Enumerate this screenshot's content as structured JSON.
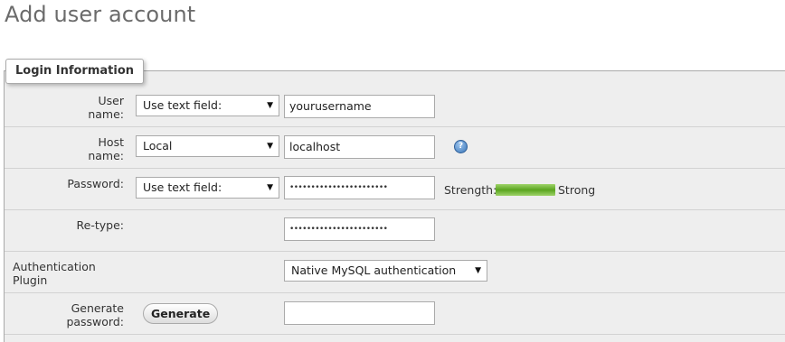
{
  "page": {
    "title": "Add user account"
  },
  "fieldset": {
    "legend": "Login Information"
  },
  "user_name": {
    "label": "User name:",
    "mode_select": "Use text field:",
    "value": "yourusername"
  },
  "host_name": {
    "label": "Host name:",
    "mode_select": "Local",
    "value": "localhost",
    "help_icon": "help-question-icon"
  },
  "password": {
    "label": "Password:",
    "mode_select": "Use text field:",
    "value_masked": "•••••••••••••••••••••••",
    "strength_label": "Strength:",
    "strength_text": "Strong",
    "strength_level": 1.0,
    "strength_color": "#5aa51f"
  },
  "retype": {
    "label": "Re-type:",
    "value_masked": "•••••••••••••••••••••••"
  },
  "auth_plugin": {
    "label": "Authentication Plugin",
    "selected": "Native MySQL authentication"
  },
  "generate": {
    "label": "Generate password:",
    "button_label": "Generate",
    "value": ""
  },
  "select_arrow": "▼"
}
